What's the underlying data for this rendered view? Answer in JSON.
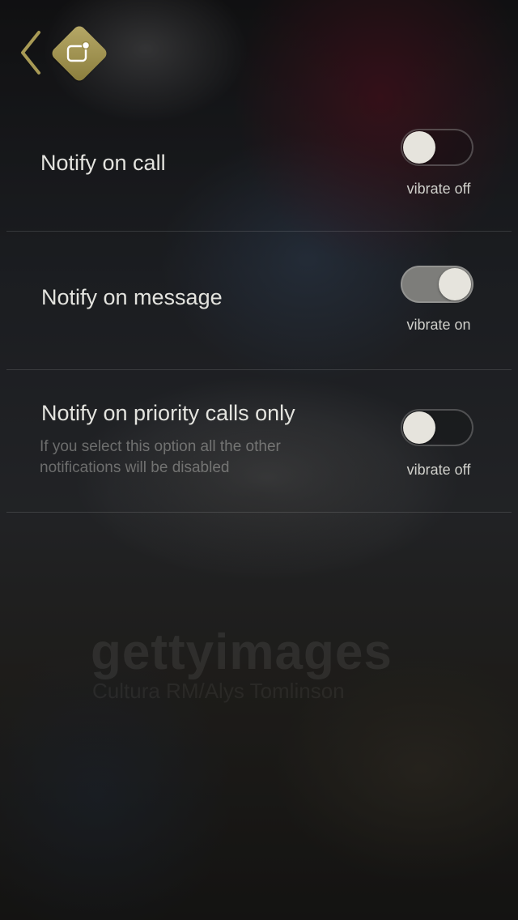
{
  "header": {
    "back_icon": "chevron-left-icon",
    "logo_icon": "notification-badge-icon",
    "accent_color": "#a89a55"
  },
  "settings": [
    {
      "label": "Notify on call",
      "description": "",
      "toggle_on": false,
      "state_label": "vibrate off"
    },
    {
      "label": "Notify on message",
      "description": "",
      "toggle_on": true,
      "state_label": "vibrate on"
    },
    {
      "label": "Notify on priority calls only",
      "description": "If you select this option all the other notifications will be disabled",
      "toggle_on": false,
      "state_label": "vibrate off"
    }
  ],
  "watermark": {
    "brand": "gettyimages",
    "credit": "Cultura RM/Alys Tomlinson"
  }
}
